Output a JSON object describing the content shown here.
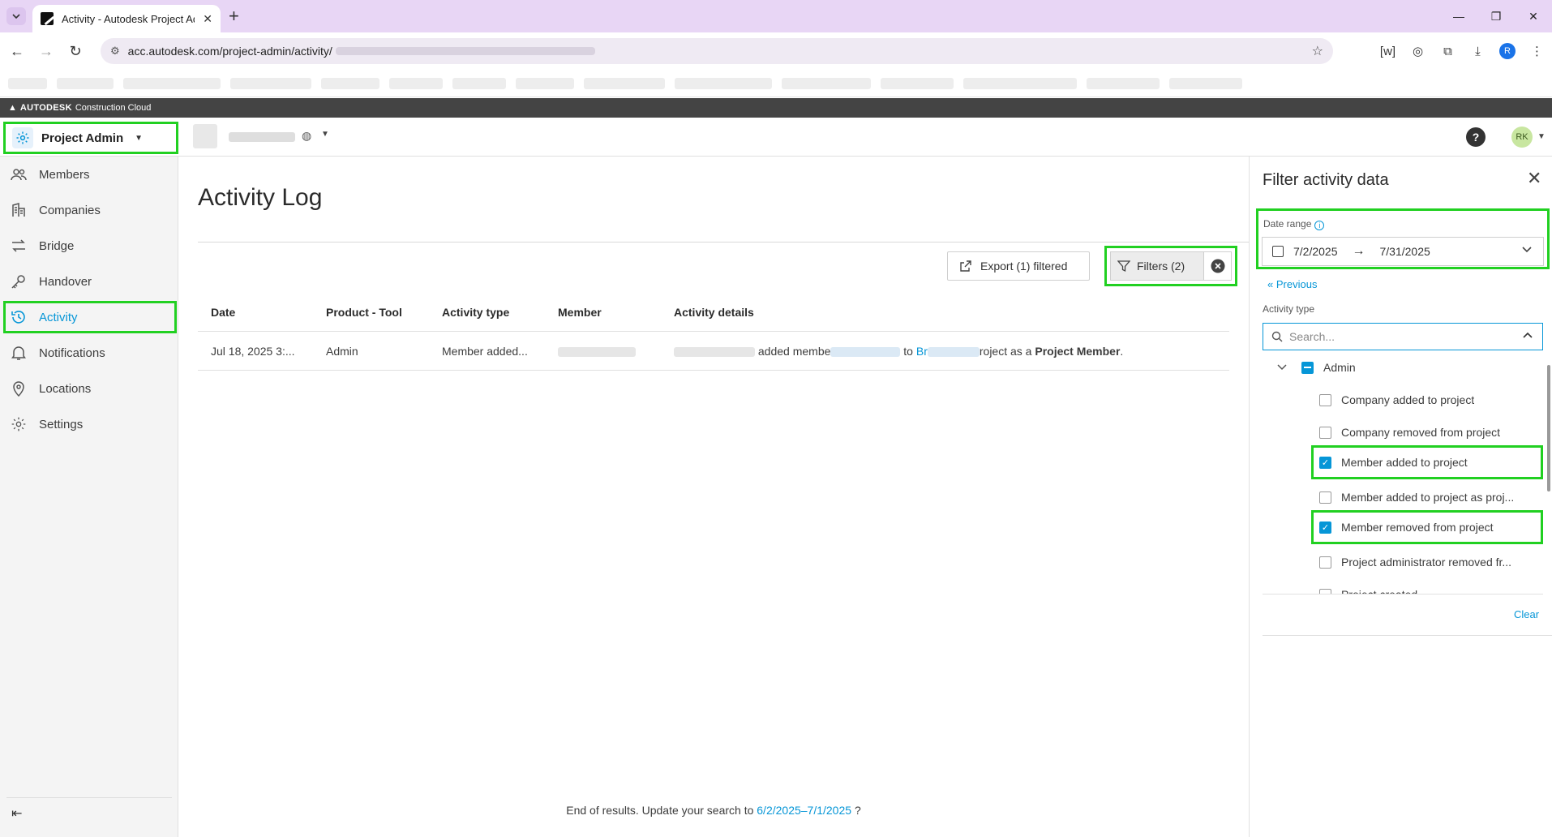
{
  "browser": {
    "tab_title": "Activity - Autodesk Project Adm",
    "url": "acc.autodesk.com/project-admin/activity/",
    "profile_initial": "R"
  },
  "acc": {
    "brand": "AUTODESK",
    "brand_suffix": "Construction Cloud",
    "module": "Project Admin",
    "help": "?",
    "avatar": "RK"
  },
  "sidebar": {
    "items": [
      {
        "label": "Members",
        "icon": "members-icon"
      },
      {
        "label": "Companies",
        "icon": "companies-icon"
      },
      {
        "label": "Bridge",
        "icon": "bridge-icon"
      },
      {
        "label": "Handover",
        "icon": "handover-icon"
      },
      {
        "label": "Activity",
        "icon": "activity-icon"
      },
      {
        "label": "Notifications",
        "icon": "bell-icon"
      },
      {
        "label": "Locations",
        "icon": "location-pin-icon"
      },
      {
        "label": "Settings",
        "icon": "gear-icon"
      }
    ]
  },
  "main": {
    "title": "Activity Log",
    "export_label": "Export (1) filtered",
    "filters_label": "Filters (2)",
    "columns": [
      "Date",
      "Product - Tool",
      "Activity type",
      "Member",
      "Activity details"
    ],
    "rows": [
      {
        "date": "Jul 18, 2025 3:...",
        "tool": "Admin",
        "type": "Member added...",
        "details_1": "added membe",
        "details_2": "to",
        "details_3": "Br",
        "details_4": "roject as a",
        "details_bold": "Project Member",
        "details_end": "."
      }
    ],
    "end_text": "End of results. Update your search to",
    "end_link": "6/2/2025–7/1/2025",
    "end_suffix": "?"
  },
  "filter_panel": {
    "title": "Filter activity data",
    "date_range_label": "Date range",
    "date_from": "7/2/2025",
    "date_to": "7/31/2025",
    "previous": "Previous",
    "activity_type_label": "Activity type",
    "search_placeholder": "Search...",
    "group": "Admin",
    "options": [
      {
        "label": "Company added to project",
        "checked": false
      },
      {
        "label": "Company removed from project",
        "checked": false
      },
      {
        "label": "Member added to project",
        "checked": true
      },
      {
        "label": "Member added to project as proj...",
        "checked": false
      },
      {
        "label": "Member removed from project",
        "checked": true
      },
      {
        "label": "Project administrator removed fr...",
        "checked": false
      },
      {
        "label": "Project created",
        "checked": false
      }
    ],
    "clear": "Clear"
  }
}
